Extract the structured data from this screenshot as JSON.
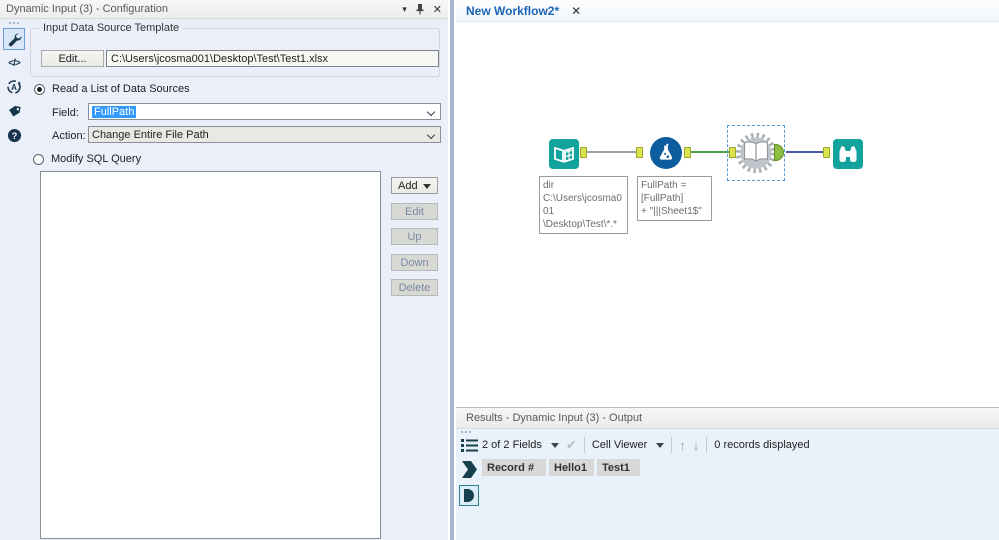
{
  "config_panel": {
    "title": "Dynamic Input (3) - Configuration",
    "template_group": {
      "label": "Input Data Source Template",
      "edit_button": "Edit...",
      "path_value": "C:\\Users\\jcosma001\\Desktop\\Test\\Test1.xlsx"
    },
    "read_list_radio": "Read a List of Data Sources",
    "field_label": "Field:",
    "field_value": "FullPath",
    "action_label": "Action:",
    "action_value": "Change Entire File Path",
    "modify_sql_radio": "Modify SQL Query",
    "buttons": {
      "add": "Add",
      "edit": "Edit",
      "up": "Up",
      "down": "Down",
      "delete": "Delete"
    }
  },
  "canvas": {
    "tab_title": "New Workflow2*",
    "annotations": {
      "directory": "dir\nC:\\Users\\jcosma001\n\\Desktop\\Test\\*.*",
      "formula": "FullPath =\n[FullPath]\n+ \"|||Sheet1$\""
    }
  },
  "results_panel": {
    "title": "Results - Dynamic Input (3) - Output",
    "fields_dropdown": "2 of 2 Fields",
    "cell_viewer": "Cell Viewer",
    "records_text": "0 records displayed",
    "columns": [
      "Record #",
      "Hello1",
      "Test1"
    ]
  },
  "icons": {
    "xml_glyph": "</>",
    "close": "✕",
    "check": "✔",
    "arrow_up": "↑",
    "arrow_down": "↓"
  },
  "colors": {
    "tool_teal": "#11a39c",
    "formula_blue": "#0d5c9e",
    "selection_blue": "#3399ff",
    "wire_gray": "#9aa0a6",
    "wire_green": "#4aa147",
    "wire_indigo": "#4a55a7",
    "anchor_yellow_green": "#dbe44e",
    "tab_blue": "#1a64b7"
  }
}
